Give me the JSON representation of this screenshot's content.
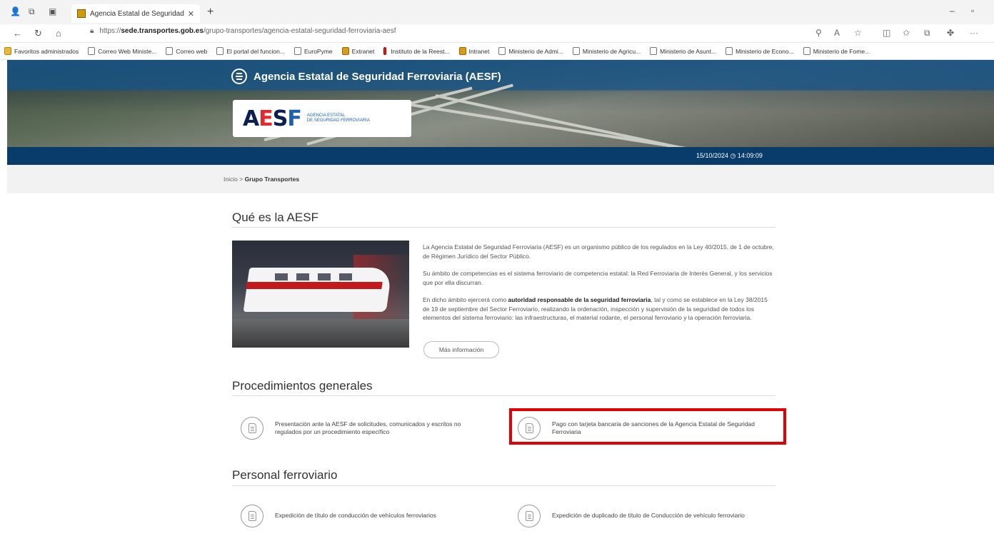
{
  "browser": {
    "tab_title": "Agencia Estatal de Seguridad Fer",
    "url_prefix": "https://",
    "url_domain": "sede.transportes.gob.es",
    "url_path": "/grupo-transportes/agencia-estatal-seguridad-ferroviaria-aesf",
    "bookmarks": [
      {
        "label": "Favoritos administrados",
        "icon": "folder-icon"
      },
      {
        "label": "Correo Web Ministe...",
        "icon": "page-icon"
      },
      {
        "label": "Correo web",
        "icon": "page-icon"
      },
      {
        "label": "El portal del funcion...",
        "icon": "page-icon"
      },
      {
        "label": "EuroPyme",
        "icon": "page-icon"
      },
      {
        "label": "Extranet",
        "icon": "gold-icon"
      },
      {
        "label": "Instituto de la Reest...",
        "icon": "red-icon"
      },
      {
        "label": "Intranet",
        "icon": "gold-icon"
      },
      {
        "label": "Ministerio de Admi...",
        "icon": "page-icon"
      },
      {
        "label": "Ministerio de Agricu...",
        "icon": "page-icon"
      },
      {
        "label": "Ministerio de Asunt...",
        "icon": "page-icon"
      },
      {
        "label": "Ministerio de Econo...",
        "icon": "page-icon"
      },
      {
        "label": "Ministerio de Fome...",
        "icon": "page-icon"
      }
    ]
  },
  "header": {
    "site_title": "Agencia Estatal de Seguridad Ferroviaria (AESF)",
    "logo_mark": "AESF",
    "logo_line1": "AGENCIA ESTATAL",
    "logo_line2": "DE SEGURIDAD FERROVIARIA",
    "datetime": "15/10/2024 ◷ 14:09:09"
  },
  "breadcrumb": {
    "home": "Inicio",
    "separator": ">",
    "current": "Grupo Transportes"
  },
  "about": {
    "title": "Qué es la AESF",
    "p1": "La Agencia Estatal de Seguridad Ferroviaria (AESF) es un organismo público de los regulados en la Ley 40/2015, de 1 de octubre, de Régimen Jurídico del Sector Público.",
    "p2": "Su ámbito de competencias es el sistema ferroviario de competencia estatal: la Red Ferroviaria de Interés General, y los servicios que por ella discurran.",
    "p3_pre": "En dicho ámbito ejercerá como ",
    "p3_bold": "autoridad responsable de la seguridad ferroviaria",
    "p3_post": ", tal y como se establece en la Ley 38/2015 de 19 de septiembre del Sector Ferroviario, realizando la ordenación, inspección y supervisión de la seguridad de todos los elementos del sistema ferroviario: las infraestructuras, el material rodante, el personal ferroviario y la operación ferroviaria.",
    "more_button": "Más información"
  },
  "procedures": {
    "title": "Procedimientos generales",
    "items": [
      {
        "label": "Presentación ante la AESF de solicitudes, comunicados y escritos no regulados por un procedimiento específico"
      },
      {
        "label": "Pago con tarjeta bancaria de sanciones de la Agencia Estatal de Seguridad Ferroviaria"
      }
    ]
  },
  "personnel": {
    "title": "Personal ferroviario",
    "items": [
      {
        "label": "Expedición de título de conducción de vehículos ferroviarios"
      },
      {
        "label": "Expedición de duplicado de título de Conducción de vehículo ferroviario"
      }
    ]
  },
  "colors": {
    "header_blue": "#0a3c6b",
    "highlight_red": "#e20000"
  }
}
